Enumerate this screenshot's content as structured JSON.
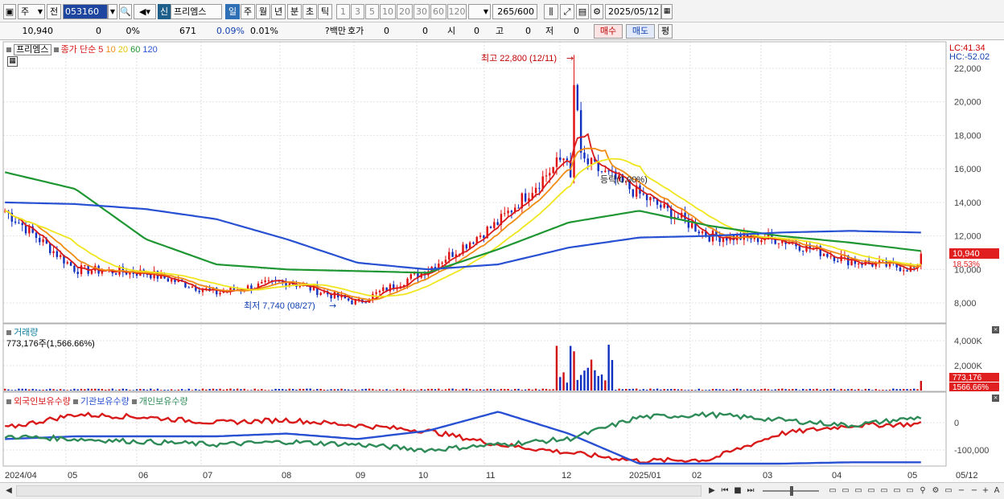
{
  "toolbar": {
    "market": "주",
    "prev": "전",
    "code": "053160",
    "sin": "신",
    "stock_name": "프리엠스",
    "periods": [
      "일",
      "주",
      "월",
      "년",
      "분",
      "초",
      "틱"
    ],
    "minutes": [
      "1",
      "3",
      "5",
      "10",
      "20",
      "30",
      "60",
      "120"
    ],
    "count": "265",
    "count_total": "/600",
    "date": "2025/05/12"
  },
  "quote": {
    "price": "10,940",
    "change": "0",
    "change_pct": "0%",
    "volume": "671",
    "turnover_pct": "0.09%",
    "vol_pct": "0.01%",
    "unit_label": "?백만",
    "hoga_label": "호가",
    "hoga1": "0",
    "hoga2": "0",
    "open_label": "시",
    "open": "0",
    "high_label": "고",
    "high": "0",
    "low_label": "저",
    "low": "0",
    "buy": "매수",
    "sell": "매도",
    "avg": "평"
  },
  "price_panel": {
    "legend_name": "프리엠스",
    "ma_label": "종가 단순",
    "ma_periods": [
      "5",
      "10",
      "20",
      "60",
      "120"
    ],
    "ma_colors": [
      "#d91a1a",
      "#f08c14",
      "#f0e61e",
      "#1e9632",
      "#2850d2"
    ],
    "lc": "LC:41.34",
    "hc": "HC:-52.02",
    "y_ticks": [
      "22,000",
      "20,000",
      "18,000",
      "16,000",
      "14,000",
      "12,000",
      "10,000",
      "8,000"
    ],
    "high_note": "최고 22,800 (12/11)",
    "low_note": "최저 7,740 (08/27)",
    "cur_note": "등락(0.00%)",
    "price_tag": "10,940",
    "pct_tag": "18.53%"
  },
  "volume_panel": {
    "title": "거래량",
    "subtitle": "773,176주(1,566.66%)",
    "y_ticks": [
      "4,000K",
      "2,000K"
    ],
    "tag1": "773,176",
    "tag2": "1566.66%"
  },
  "holding_panel": {
    "series": [
      "외국인보유수량",
      "기관보유수량",
      "개인보유수량"
    ],
    "colors": [
      "#d91a1a",
      "#2850d2",
      "#2e8b57"
    ],
    "y_ticks": [
      "0",
      "-100,000"
    ]
  },
  "x_labels": [
    "2024/04",
    "05",
    "06",
    "07",
    "08",
    "09",
    "10",
    "11",
    "12",
    "2025/01",
    "02",
    "03",
    "04",
    "05",
    "05/12"
  ],
  "chart_data": {
    "type": "line",
    "title": "프리엠스",
    "x": [
      "2024/04",
      "05",
      "06",
      "07",
      "08",
      "09",
      "10",
      "11",
      "12",
      "2025/01",
      "02",
      "03",
      "04",
      "05"
    ],
    "series": [
      {
        "name": "종가 단순 5",
        "values": [
          13500,
          10000,
          9800,
          8600,
          9300,
          8000,
          10000,
          12800,
          17000,
          14500,
          12000,
          11800,
          10500,
          10000
        ]
      },
      {
        "name": "120",
        "values": [
          14000,
          13900,
          13600,
          13000,
          11800,
          10400,
          10000,
          10300,
          11300,
          11900,
          12000,
          12200,
          12300,
          12200
        ]
      },
      {
        "name": "60",
        "values": [
          15800,
          14800,
          11800,
          10300,
          10000,
          9900,
          9800,
          11200,
          12800,
          13500,
          12600,
          12000,
          11600,
          11100
        ]
      }
    ],
    "extremes": {
      "high": 22800,
      "high_date": "12/11",
      "low": 7740,
      "low_date": "08/27"
    },
    "last_close": 10940,
    "ylim": [
      7000,
      23000
    ],
    "volume_last": 773176
  }
}
